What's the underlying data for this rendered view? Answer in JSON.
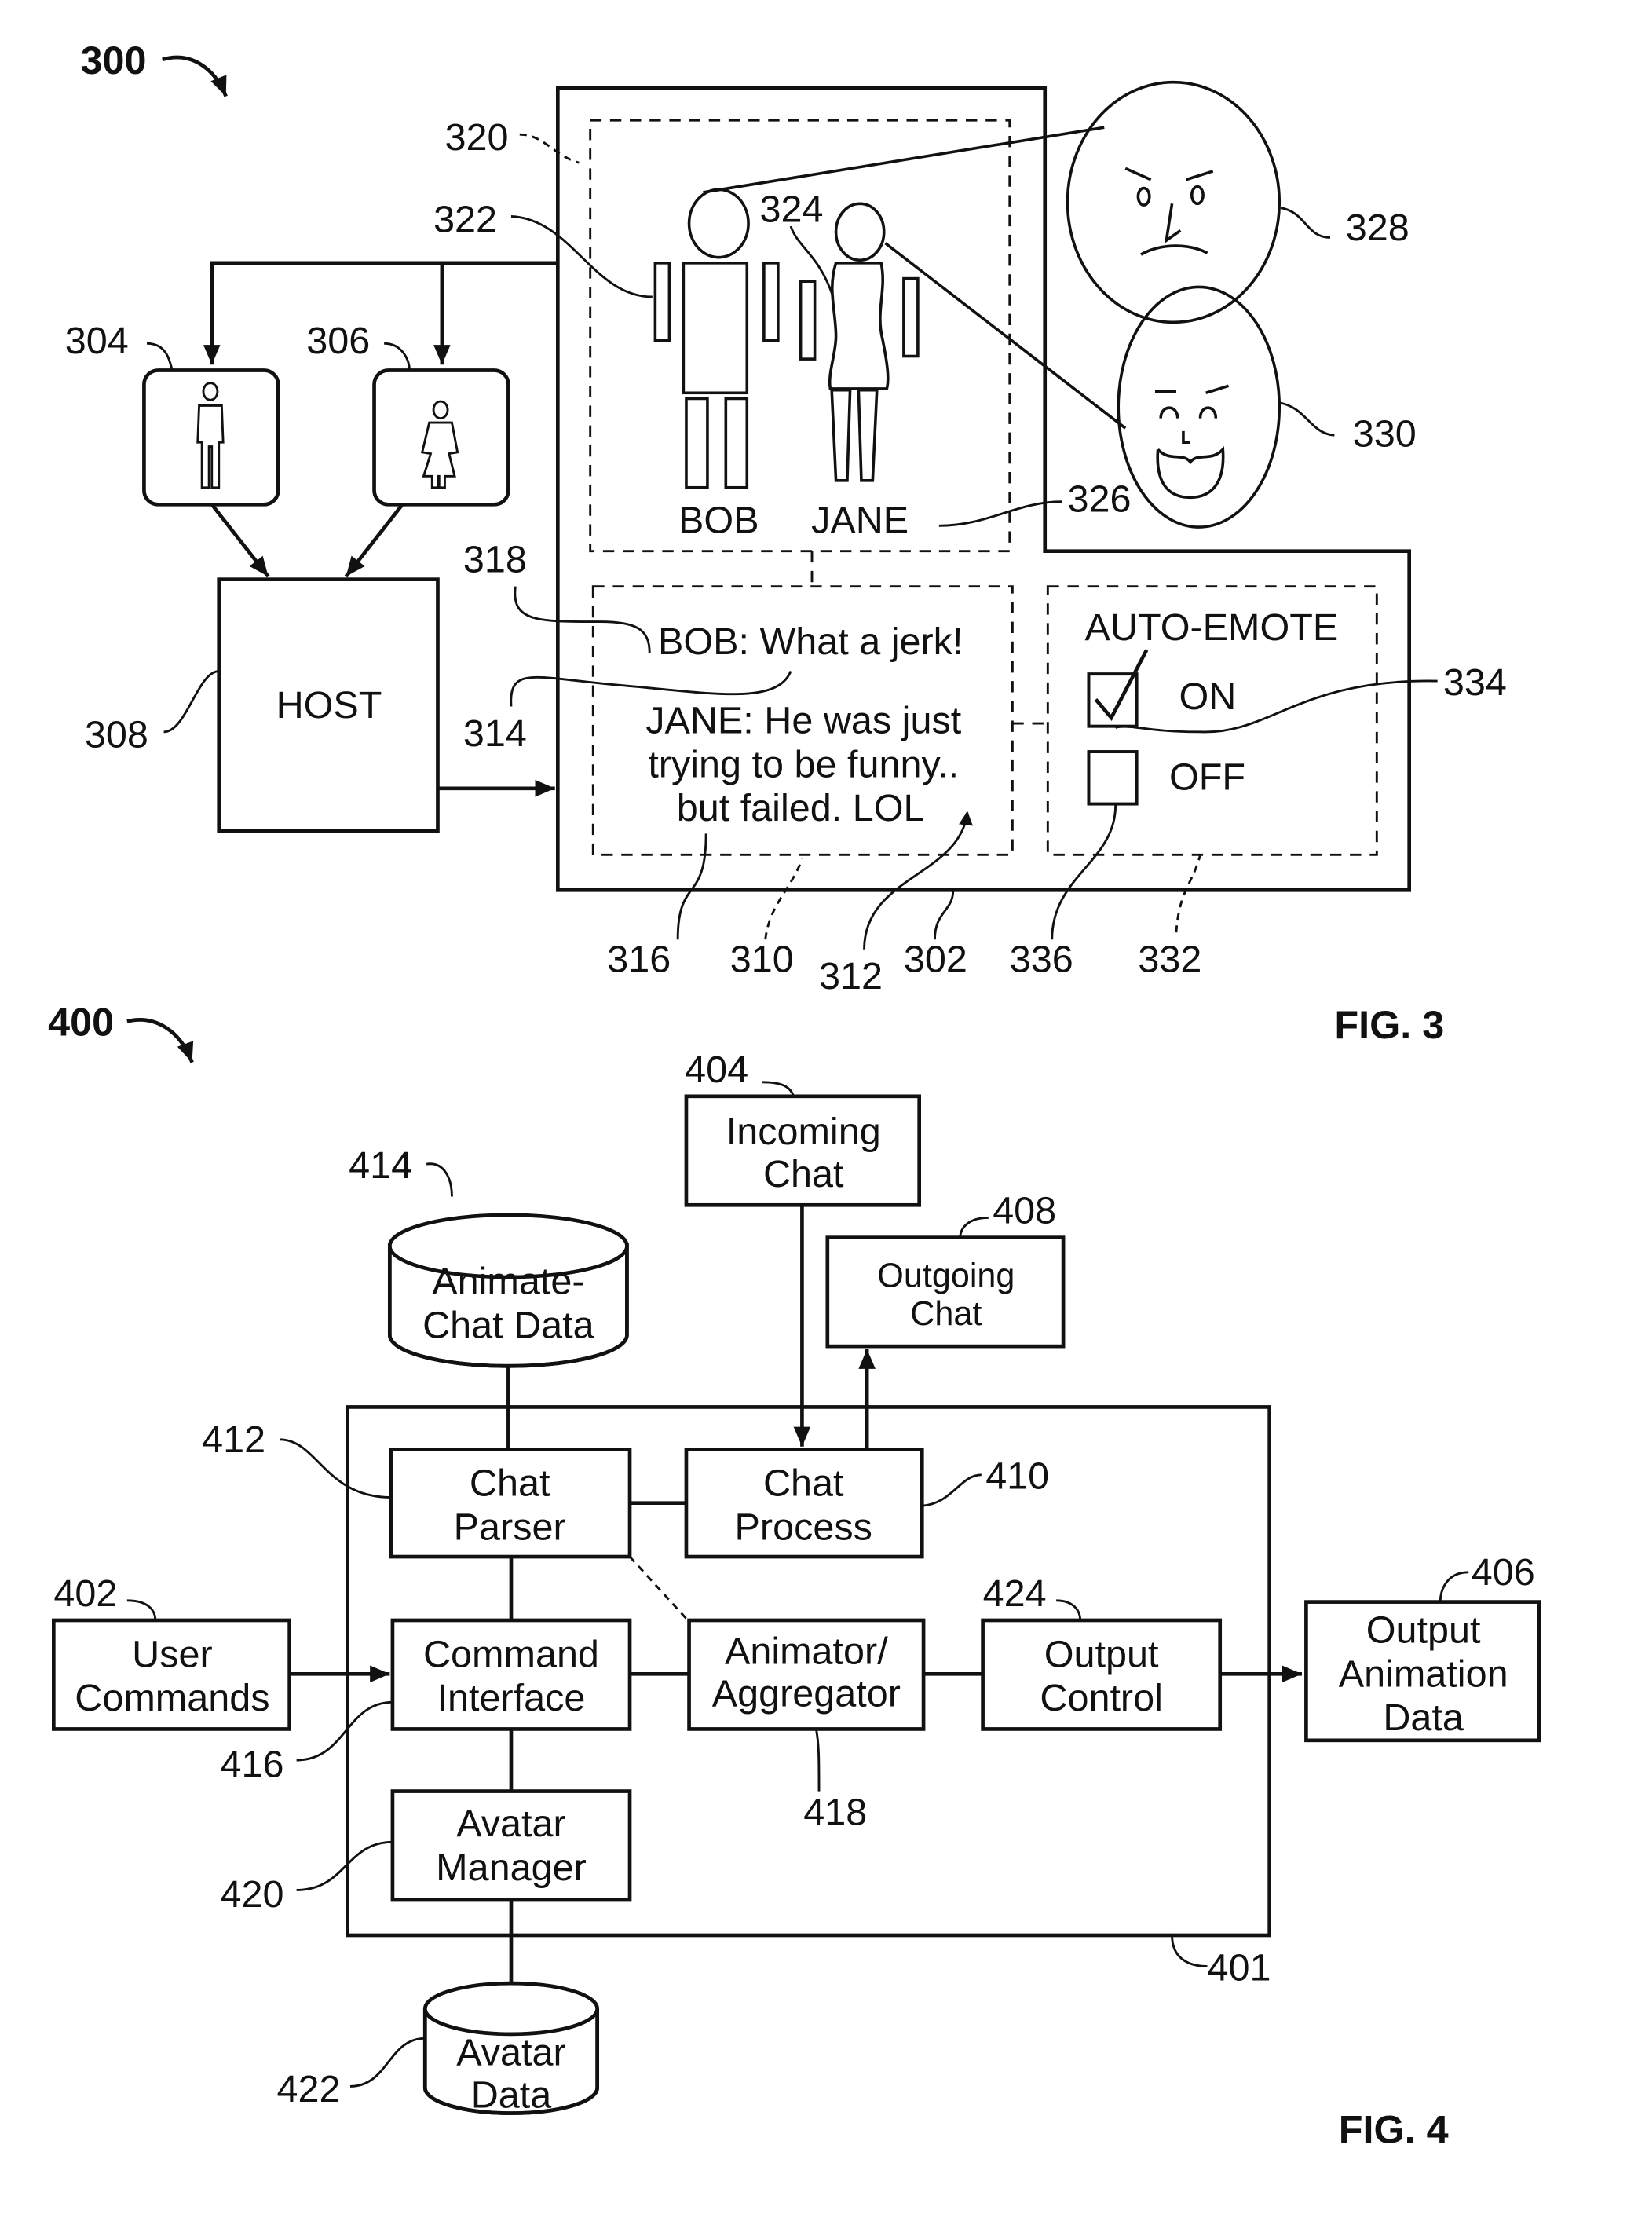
{
  "fig3": {
    "figure_ref": "300",
    "caption": "FIG. 3",
    "refs": {
      "display": "302",
      "male_avatar_icon": "304",
      "female_avatar_icon": "306",
      "host": "308",
      "chat_area": "310",
      "arrow_312": "312",
      "line_314": "314",
      "line_316": "316",
      "line_318": "318",
      "avatar_area": "320",
      "bob_avatar": "322",
      "jane_avatar": "324",
      "names": "326",
      "angry_face": "328",
      "happy_face": "330",
      "auto_emote_panel": "332",
      "on_checkbox": "334",
      "off_checkbox": "336"
    },
    "host_label": "HOST",
    "avatar_names": [
      "BOB",
      "JANE"
    ],
    "chat_lines": {
      "bob": "BOB: What a jerk!",
      "jane": [
        "JANE: He was just",
        "trying to be funny..",
        "but failed. LOL"
      ]
    },
    "auto_emote": {
      "title": "AUTO-EMOTE",
      "options": [
        {
          "label": "ON",
          "checked": true
        },
        {
          "label": "OFF",
          "checked": false
        }
      ]
    }
  },
  "fig4": {
    "figure_ref": "400",
    "caption": "FIG. 4",
    "system_ref": "401",
    "blocks": {
      "user_commands": {
        "ref": "402",
        "lines": [
          "User",
          "Commands"
        ]
      },
      "incoming_chat": {
        "ref": "404",
        "lines": [
          "Incoming",
          "Chat"
        ]
      },
      "output_animation_data": {
        "ref": "406",
        "lines": [
          "Output",
          "Animation",
          "Data"
        ]
      },
      "outgoing_chat": {
        "ref": "408",
        "lines": [
          "Outgoing",
          "Chat"
        ]
      },
      "chat_process": {
        "ref": "410",
        "lines": [
          "Chat",
          "Process"
        ]
      },
      "chat_parser": {
        "ref": "412",
        "lines": [
          "Chat",
          "Parser"
        ]
      },
      "animate_chat_data": {
        "ref": "414",
        "lines": [
          "Animate-",
          "Chat Data"
        ]
      },
      "command_interface": {
        "ref": "416",
        "lines": [
          "Command",
          "Interface"
        ]
      },
      "animator_aggregator": {
        "ref": "418",
        "lines": [
          "Animator/",
          "Aggregator"
        ]
      },
      "avatar_manager": {
        "ref": "420",
        "lines": [
          "Avatar",
          "Manager"
        ]
      },
      "avatar_data": {
        "ref": "422",
        "lines": [
          "Avatar",
          "Data"
        ]
      },
      "output_control": {
        "ref": "424",
        "lines": [
          "Output",
          "Control"
        ]
      }
    }
  }
}
